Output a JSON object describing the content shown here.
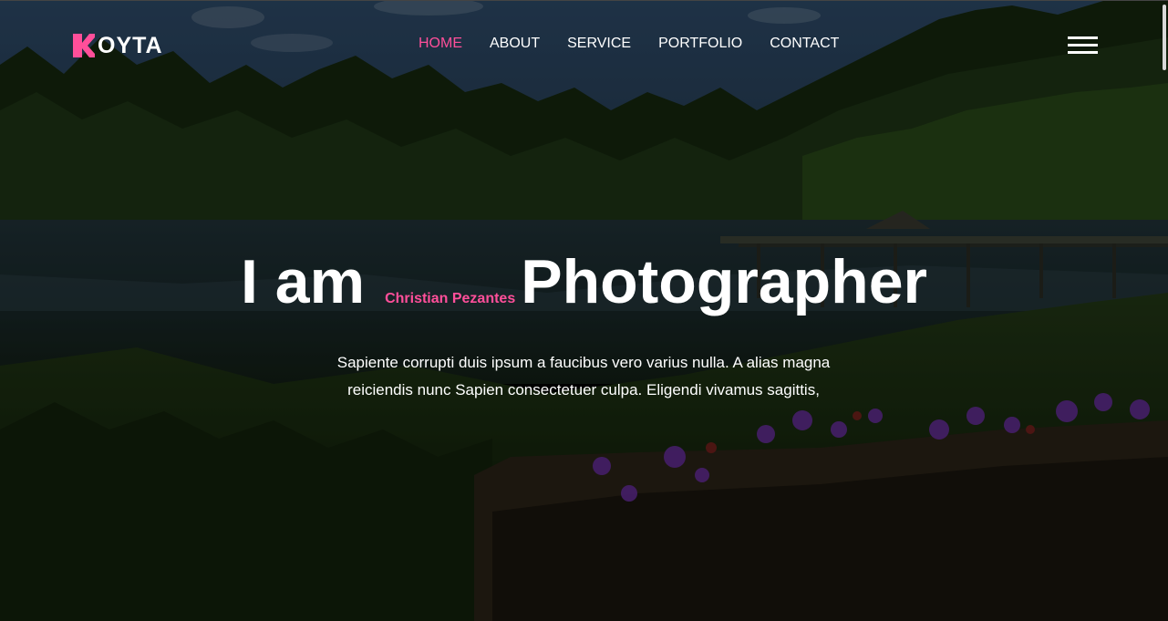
{
  "brand": {
    "logo_text": "OYTA",
    "logo_mark_color": "#ff4f9a"
  },
  "nav": {
    "items": [
      {
        "label": "HOME",
        "active": true
      },
      {
        "label": "ABOUT",
        "active": false
      },
      {
        "label": "SERVICE",
        "active": false
      },
      {
        "label": "PORTFOLIO",
        "active": false
      },
      {
        "label": "CONTACT",
        "active": false
      }
    ],
    "menu_icon": "hamburger-icon"
  },
  "hero": {
    "heading_start": "I am",
    "name": "Christian Pezantes",
    "heading_end": "Photographer",
    "description_line1": "Sapiente corrupti duis ipsum a faucibus vero varius nulla. A alias magna",
    "description_line2": "reiciendis nunc Sapien consectetuer culpa. Eligendi vivamus sagittis,"
  },
  "colors": {
    "accent": "#ff4f9a",
    "text": "#ffffff"
  }
}
